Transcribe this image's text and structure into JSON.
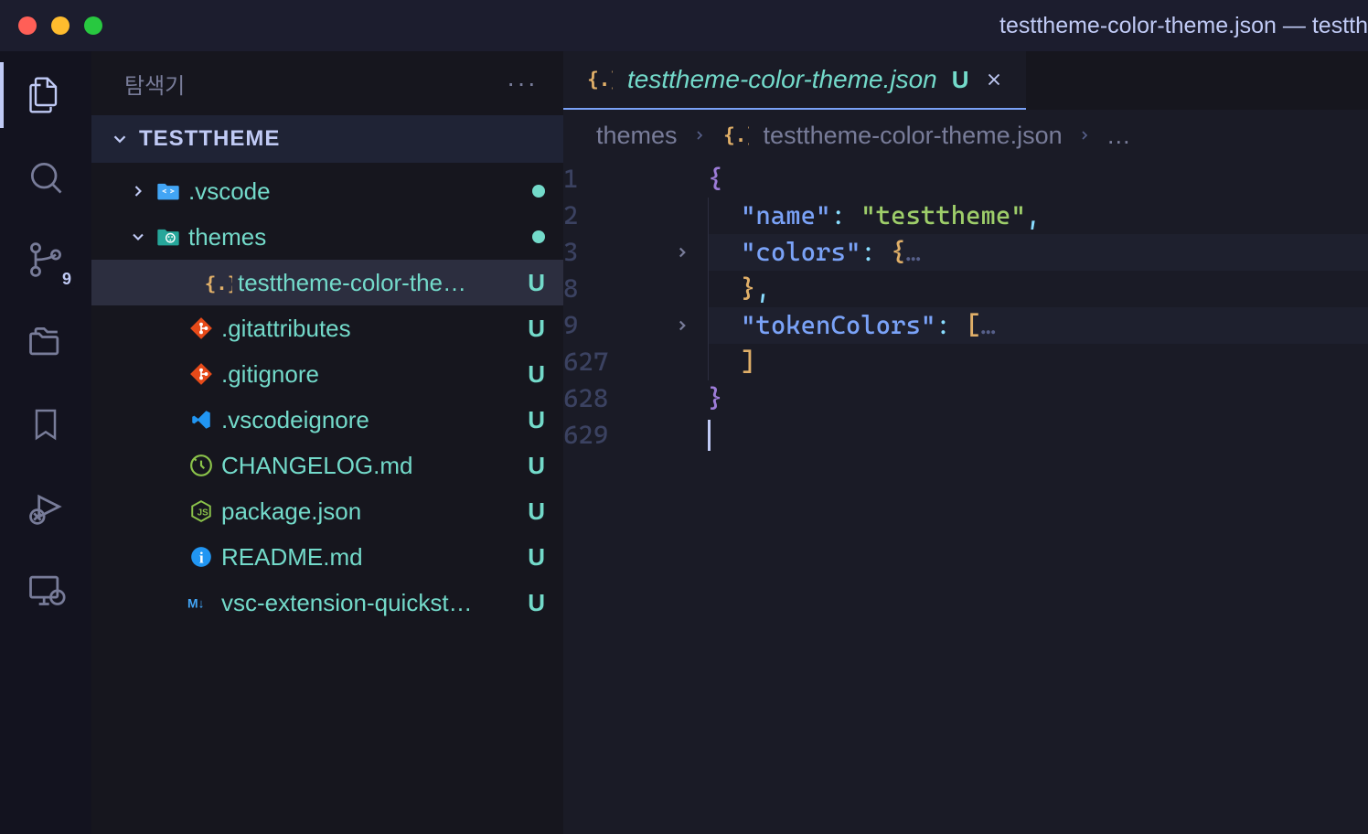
{
  "window": {
    "title": "testtheme-color-theme.json — testth"
  },
  "sidebar": {
    "title": "탐색기",
    "folder": "TESTTHEME",
    "tree": [
      {
        "label": ".vscode",
        "type": "folder-collapsed",
        "icon": "folder-vscode",
        "status": "dot",
        "indent": 36
      },
      {
        "label": "themes",
        "type": "folder-open",
        "icon": "folder-theme",
        "status": "dot",
        "indent": 36
      },
      {
        "label": "testtheme-color-the…",
        "type": "file",
        "icon": "json",
        "status": "U",
        "indent": 90,
        "selected": true
      },
      {
        "label": ".gitattributes",
        "type": "file",
        "icon": "git-orange",
        "status": "U",
        "indent": 72
      },
      {
        "label": ".gitignore",
        "type": "file",
        "icon": "git-orange",
        "status": "U",
        "indent": 72
      },
      {
        "label": ".vscodeignore",
        "type": "file",
        "icon": "vscode-blue",
        "status": "U",
        "indent": 72
      },
      {
        "label": "CHANGELOG.md",
        "type": "file",
        "icon": "changelog",
        "status": "U",
        "indent": 72
      },
      {
        "label": "package.json",
        "type": "file",
        "icon": "nodejs",
        "status": "U",
        "indent": 72
      },
      {
        "label": "README.md",
        "type": "file",
        "icon": "info",
        "status": "U",
        "indent": 72
      },
      {
        "label": "vsc-extension-quickst…",
        "type": "file",
        "icon": "markdown",
        "status": "U",
        "indent": 72
      }
    ]
  },
  "scm_badge": "9",
  "tab": {
    "label": "testtheme-color-theme.json",
    "status": "U"
  },
  "breadcrumb": {
    "seg1": "themes",
    "seg2": "testtheme-color-theme.json",
    "seg3": "…"
  },
  "editor": {
    "lines": [
      {
        "num": "1",
        "fold": "",
        "hl": false,
        "tokens": [
          {
            "t": "{",
            "c": "brace"
          }
        ]
      },
      {
        "num": "2",
        "fold": "",
        "hl": false,
        "tokens": [
          {
            "t": "  ",
            "c": "ind"
          },
          {
            "t": "\"name\"",
            "c": "key"
          },
          {
            "t": ": ",
            "c": "punct"
          },
          {
            "t": "\"testtheme\"",
            "c": "str"
          },
          {
            "t": ",",
            "c": "punct"
          }
        ]
      },
      {
        "num": "3",
        "fold": ">",
        "hl": true,
        "tokens": [
          {
            "t": "  ",
            "c": "ind"
          },
          {
            "t": "\"colors\"",
            "c": "key"
          },
          {
            "t": ": ",
            "c": "punct"
          },
          {
            "t": "{",
            "c": "bracket"
          },
          {
            "t": "…",
            "c": "ellipsis"
          }
        ]
      },
      {
        "num": "8",
        "fold": "",
        "hl": false,
        "tokens": [
          {
            "t": "  ",
            "c": "ind"
          },
          {
            "t": "}",
            "c": "bracket"
          },
          {
            "t": ",",
            "c": "punct"
          }
        ]
      },
      {
        "num": "9",
        "fold": ">",
        "hl": true,
        "tokens": [
          {
            "t": "  ",
            "c": "ind"
          },
          {
            "t": "\"tokenColors\"",
            "c": "key"
          },
          {
            "t": ": ",
            "c": "punct"
          },
          {
            "t": "[",
            "c": "bracket"
          },
          {
            "t": "…",
            "c": "ellipsis"
          }
        ]
      },
      {
        "num": "627",
        "fold": "",
        "hl": false,
        "tokens": [
          {
            "t": "  ",
            "c": "ind"
          },
          {
            "t": "]",
            "c": "bracket"
          }
        ]
      },
      {
        "num": "628",
        "fold": "",
        "hl": false,
        "tokens": [
          {
            "t": "}",
            "c": "brace"
          }
        ]
      },
      {
        "num": "629",
        "fold": "",
        "hl": false,
        "tokens": [
          {
            "t": "cursor",
            "c": "cursor"
          }
        ]
      }
    ]
  }
}
